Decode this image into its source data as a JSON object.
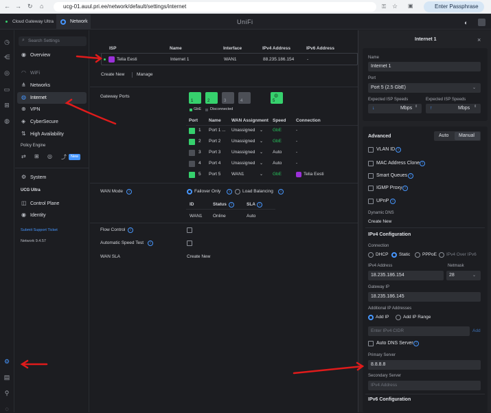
{
  "browser": {
    "url": "ucg-01.auul.pri.ee/network/default/settings/internet",
    "passphrase_btn": "Enter Passphrase"
  },
  "app": {
    "tab_device": "Cloud Gateway Ultra",
    "tab_network": "Network",
    "brand": "UniFi"
  },
  "sidebar": {
    "search_placeholder": "Search Settings",
    "overview": "Overview",
    "wifi": "WiFi",
    "networks": "Networks",
    "internet": "Internet",
    "vpn": "VPN",
    "cybersecure": "CyberSecure",
    "high_availability": "High Availability",
    "policy_engine": "Policy Engine",
    "policy_new": "New",
    "system": "System",
    "ucg_ultra": "UCG Ultra",
    "control_plane": "Control Plane",
    "identity": "Identity",
    "submit_ticket": "Submit Support Ticket",
    "version": "Network 9.4.57"
  },
  "isp_table": {
    "headers": [
      "ISP",
      "Name",
      "Interface",
      "IPv4 Address",
      "IPv6 Address"
    ],
    "row": {
      "isp": "Telia Eesti",
      "name": "Internet 1",
      "interface": "WAN1",
      "ipv4": "88.235.186.154",
      "ipv6": "-"
    },
    "create_new": "Create New",
    "manage": "Manage"
  },
  "gateway_ports": {
    "label": "Gateway Ports",
    "legend_gbe": "GbE",
    "legend_disconnected": "Disconnected",
    "headers": [
      "Port",
      "Name",
      "WAN Assignment",
      "Speed",
      "Connection"
    ],
    "rows": [
      {
        "num": "1",
        "name": "Port 1 ...",
        "wan": "Unassigned",
        "speed": "GbE",
        "conn": "-",
        "active": true
      },
      {
        "num": "2",
        "name": "Port 2",
        "wan": "Unassigned",
        "speed": "GbE",
        "conn": "-",
        "active": true
      },
      {
        "num": "3",
        "name": "Port 3",
        "wan": "Unassigned",
        "speed": "Auto",
        "conn": "-",
        "active": false
      },
      {
        "num": "4",
        "name": "Port 4",
        "wan": "Unassigned",
        "speed": "Auto",
        "conn": "-",
        "active": false
      },
      {
        "num": "5",
        "name": "Port 5",
        "wan": "WAN1",
        "speed": "GbE",
        "conn": "Telia Eesti",
        "active": true
      }
    ]
  },
  "wan_mode": {
    "label": "WAN Mode",
    "failover": "Failover Only",
    "load_balancing": "Load Balancing",
    "headers": [
      "ID",
      "Status",
      "SLA"
    ],
    "row": {
      "id": "WAN1",
      "status": "Online",
      "sla": "Auto"
    }
  },
  "flow_control": "Flow Control",
  "auto_speed_test": "Automatic Speed Test",
  "wan_sla": {
    "label": "WAN SLA",
    "create_new": "Create New"
  },
  "panel": {
    "title": "Internet 1",
    "name_label": "Name",
    "name_value": "Internet 1",
    "port_label": "Port",
    "port_value": "Port 5 (2.5 GbE)",
    "exp_down_label": "Expected ISP Speeds",
    "exp_up_label": "Expected ISP Speeds",
    "unit": "Mbps",
    "advanced": "Advanced",
    "auto": "Auto",
    "manual": "Manual",
    "vlan_id": "VLAN ID",
    "mac_clone": "MAC Address Clone",
    "smart_queues": "Smart Queues",
    "igmp_proxy": "IGMP Proxy",
    "upnp": "UPnP",
    "dynamic_dns": "Dynamic DNS",
    "create_new": "Create New",
    "ipv4_config": "IPv4 Configuration",
    "connection": "Connection",
    "dhcp": "DHCP",
    "static": "Static",
    "pppoe": "PPPoE",
    "ipv4_over_ipv6": "IPv4 Over IPv6",
    "ipv4_label": "IPv4 Address",
    "ipv4_value": "18.235.186.154",
    "netmask_label": "Netmask",
    "netmask_value": "28",
    "gateway_label": "Gateway IP",
    "gateway_value": "18.235.186.145",
    "additional_ip": "Additional IP Addresses",
    "add_ip": "Add IP",
    "add_ip_range": "Add IP Range",
    "cidr_placeholder": "Enter IPv4 CIDR",
    "add": "Add",
    "auto_dns": "Auto DNS Server",
    "primary_label": "Primary Server",
    "primary_value": "8.8.8.8",
    "secondary_label": "Secondary Server",
    "secondary_placeholder": "IPv4 Address",
    "ipv6_config": "IPv6 Configuration"
  },
  "colors": {
    "accent": "#4797ff",
    "green": "#36d16d",
    "annotation": "#e01b1b"
  }
}
